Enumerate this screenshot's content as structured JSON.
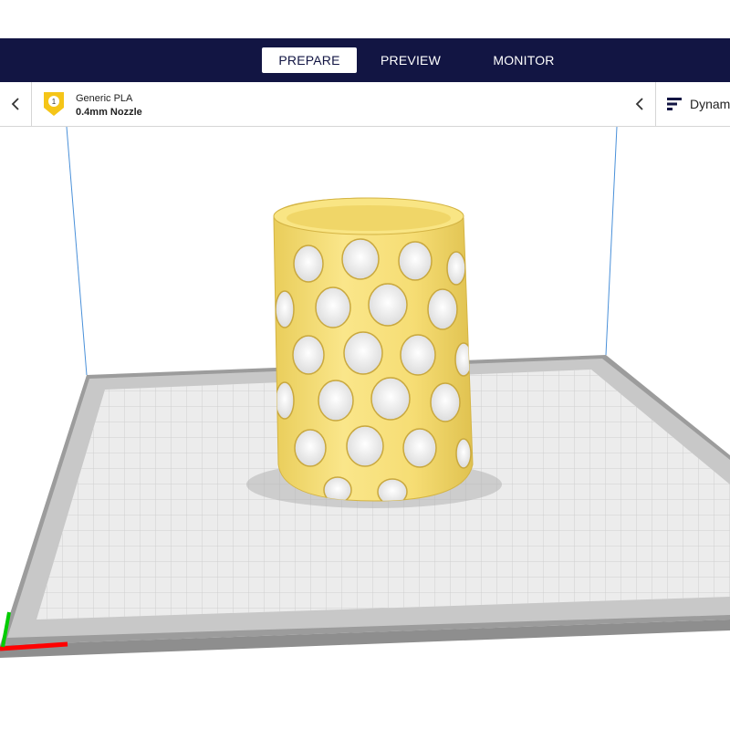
{
  "stages": {
    "prepare": "PREPARE",
    "preview": "PREVIEW",
    "monitor": "MONITOR",
    "active": "PREPARE"
  },
  "printer": {
    "extruder_number": "1",
    "material": "Generic PLA",
    "nozzle": "0.4mm Nozzle"
  },
  "profile": {
    "label": "Dynam"
  },
  "colors": {
    "header": "#121543",
    "model": "#f7e07a",
    "extruder_badge": "#f5c518",
    "axis_x": "#ff0000",
    "axis_y": "#00cc00",
    "build_plate": "#e8e8e8"
  },
  "icons": {
    "back": "chevron-left-icon",
    "extruder": "extruder-badge-icon",
    "profile": "print-settings-icon"
  }
}
